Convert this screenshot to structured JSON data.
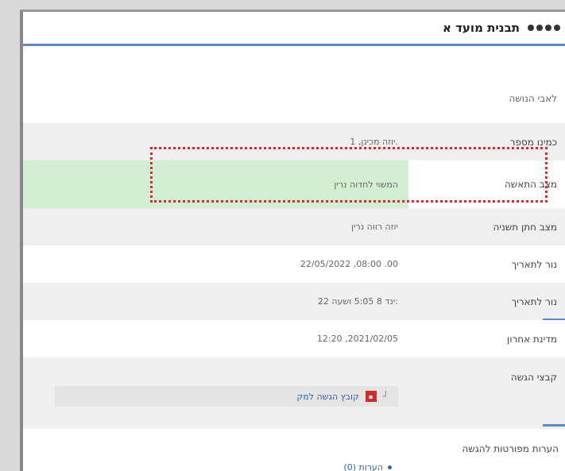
{
  "window": {
    "title": "תבנית מועד א"
  },
  "header_text": "לאבי הנושה",
  "rows": [
    {
      "label": "כמינו מספר",
      "value": "יוזה מכינן, 1."
    },
    {
      "label": "מצב התאשה",
      "value": "המשוי לחדוה נרין"
    },
    {
      "label": "מצב חתן תשניה",
      "value": "יוזה רווה נרין"
    },
    {
      "label": "נור לתאריך",
      "value": "22/05/2022 ,08:00 .00"
    },
    {
      "label": "נור לתאריך",
      "value": "ינד 8 5:05 ושעה 22:"
    },
    {
      "label": "מדינת אחרון",
      "value": "12:20 ,2021/02/05"
    }
  ],
  "attachments": {
    "label": "קבצי הגשה",
    "file_label": "קובץ הגשה למק",
    "icon": "pdf-icon"
  },
  "comments": {
    "label": "הערות מפורטות להגשה",
    "link_label": "הערות (0)"
  },
  "colors": {
    "accent": "#5b8ac7",
    "highlight_border": "#e0282a",
    "green_cell": "#d3efd3"
  }
}
